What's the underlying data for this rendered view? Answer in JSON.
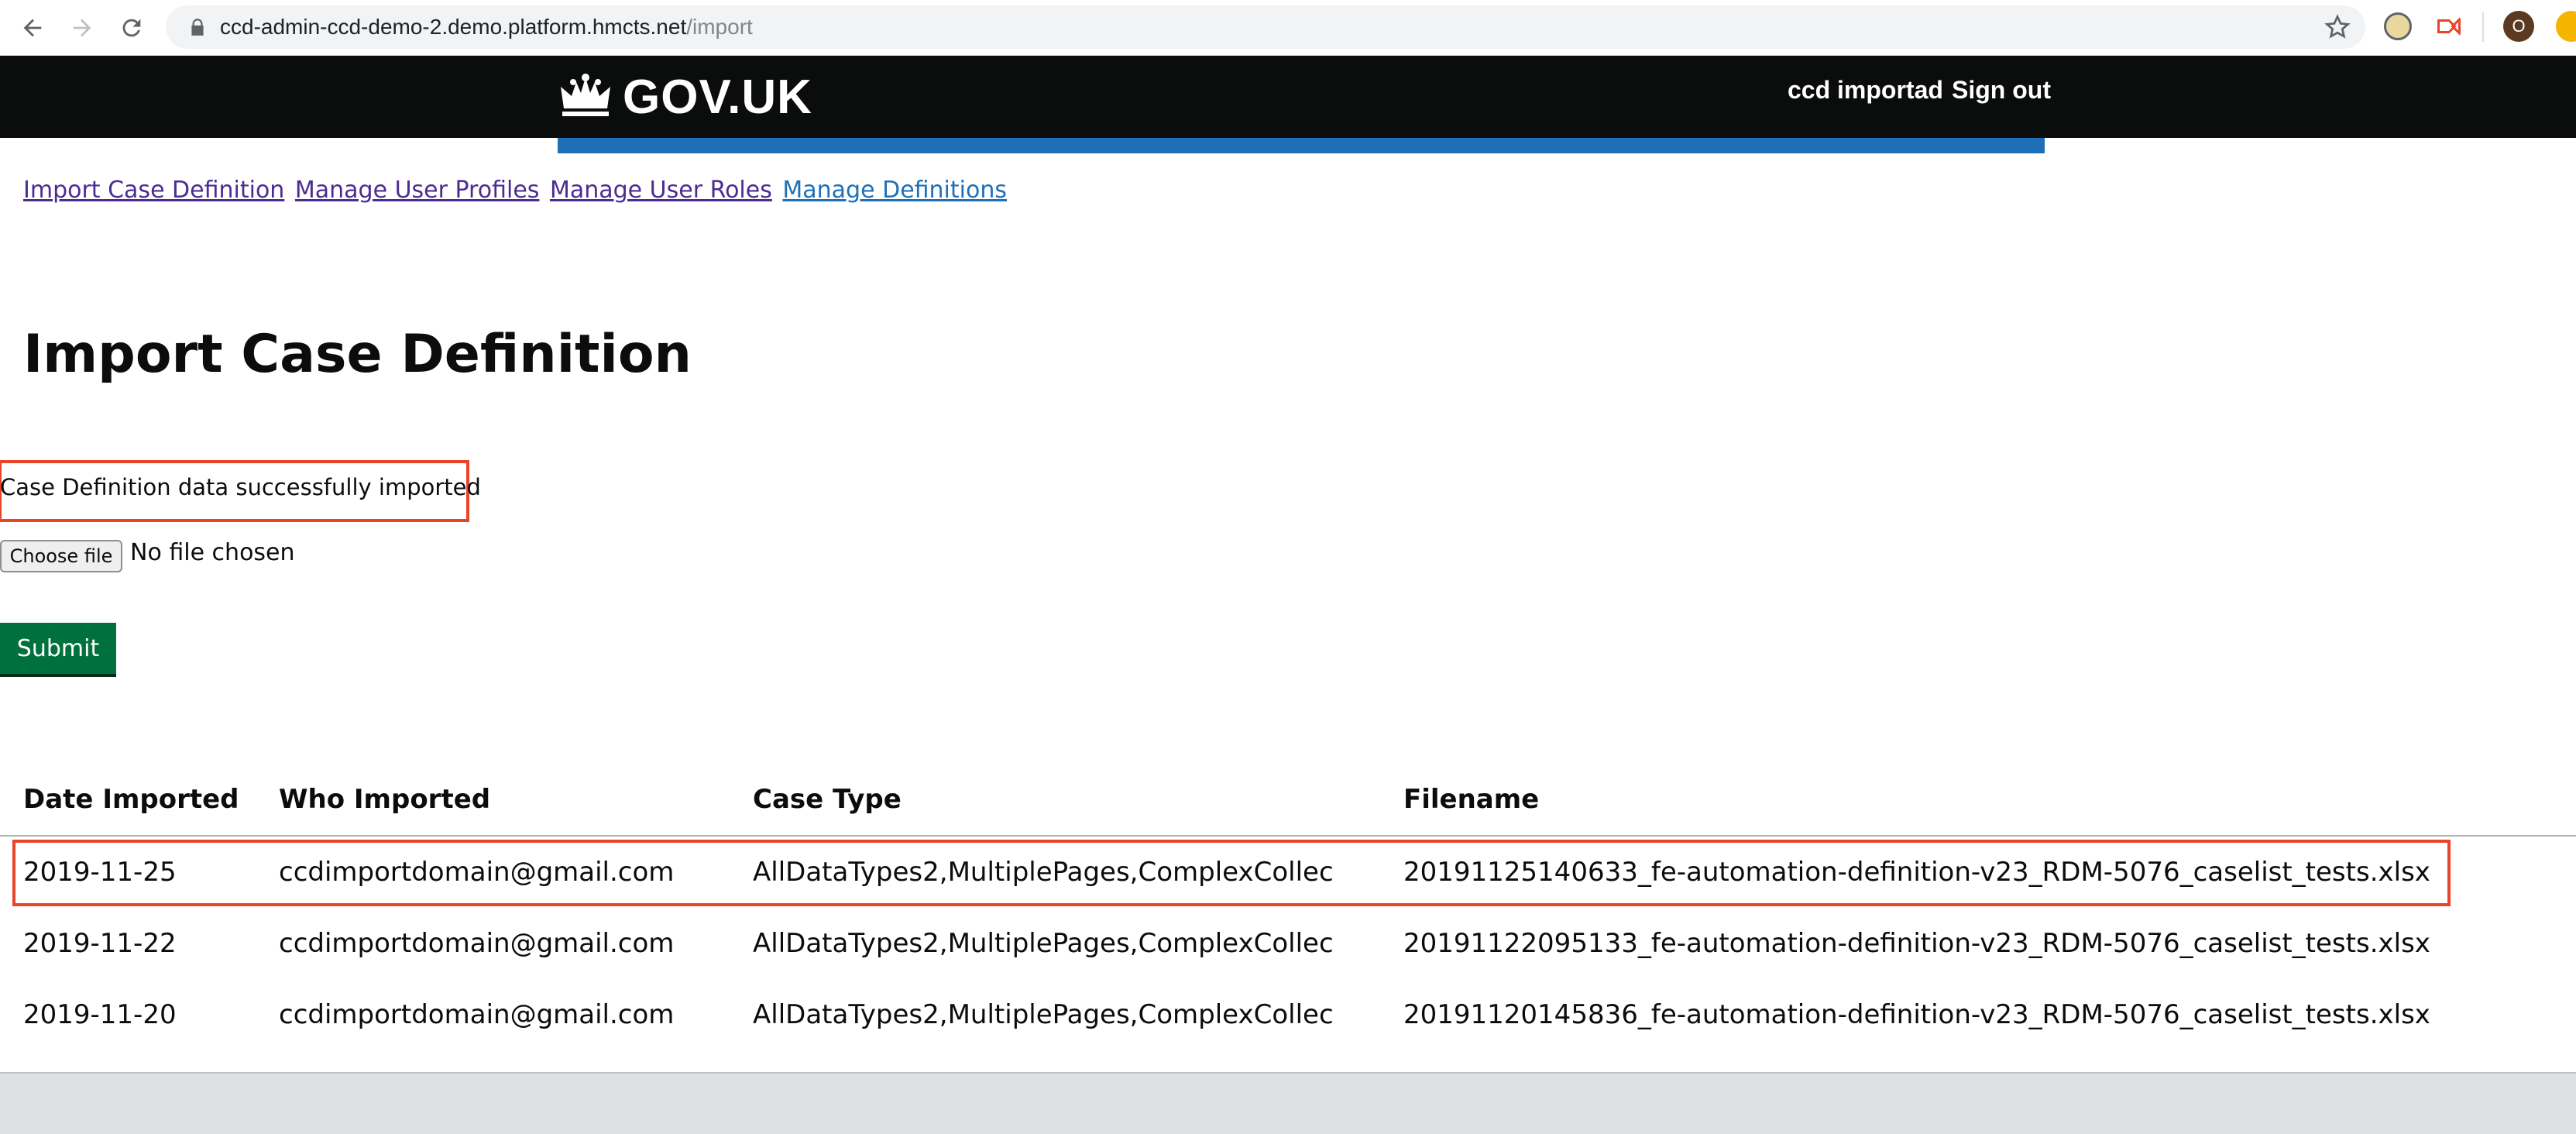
{
  "browser": {
    "url_host": "ccd-admin-ccd-demo-2.demo.platform.hmcts.net",
    "url_path": "/import",
    "profile_initial": "O"
  },
  "header": {
    "logo_text": "GOV.UK",
    "user_name": "ccd importad",
    "sign_out": "Sign out"
  },
  "nav": {
    "items": [
      {
        "label": "Import Case Definition"
      },
      {
        "label": "Manage User Profiles"
      },
      {
        "label": "Manage User Roles"
      },
      {
        "label": "Manage Definitions"
      }
    ]
  },
  "page": {
    "title": "Import Case Definition",
    "success_message": "Case Definition data successfully imported",
    "file_button": "Choose file",
    "file_status": "No file chosen",
    "submit_label": "Submit"
  },
  "table": {
    "headers": [
      "Date Imported",
      "Who Imported",
      "Case Type",
      "Filename"
    ],
    "rows": [
      [
        "2019-11-25",
        "ccdimportdomain@gmail.com",
        "AllDataTypes2,MultiplePages,ComplexCollec",
        "20191125140633_fe-automation-definition-v23_RDM-5076_caselist_tests.xlsx"
      ],
      [
        "2019-11-22",
        "ccdimportdomain@gmail.com",
        "AllDataTypes2,MultiplePages,ComplexCollec",
        "20191122095133_fe-automation-definition-v23_RDM-5076_caselist_tests.xlsx"
      ],
      [
        "2019-11-20",
        "ccdimportdomain@gmail.com",
        "AllDataTypes2,MultiplePages,ComplexCollec",
        "20191120145836_fe-automation-definition-v23_RDM-5076_caselist_tests.xlsx"
      ]
    ]
  },
  "colors": {
    "header_bg": "#0b0c0c",
    "blue_bar": "#1d70b8",
    "submit_green": "#00703c",
    "highlight_red": "#e8442a"
  }
}
